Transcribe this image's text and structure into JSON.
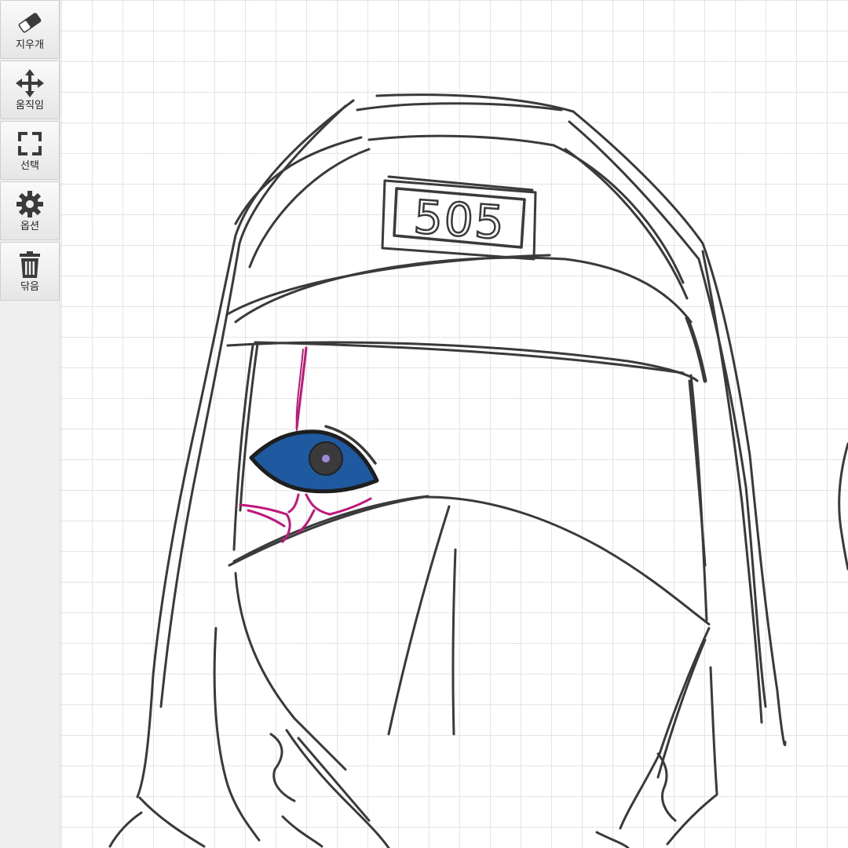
{
  "toolbar": {
    "items": [
      {
        "label": "지우개",
        "icon": "eraser-icon"
      },
      {
        "label": "움직임",
        "icon": "move-arrows-icon"
      },
      {
        "label": "선택",
        "icon": "select-frame-icon"
      },
      {
        "label": "옵션",
        "icon": "gear-icon"
      },
      {
        "label": "닦음",
        "icon": "trash-icon"
      }
    ]
  },
  "drawing": {
    "cap_badge_text": "505",
    "colors": {
      "stroke": "#3a3a3a",
      "eye_iris": "#1f5aa0",
      "veins": "#c0187a",
      "pupil_highlight": "#9f88d6",
      "grid": "#e4e4e4"
    }
  }
}
